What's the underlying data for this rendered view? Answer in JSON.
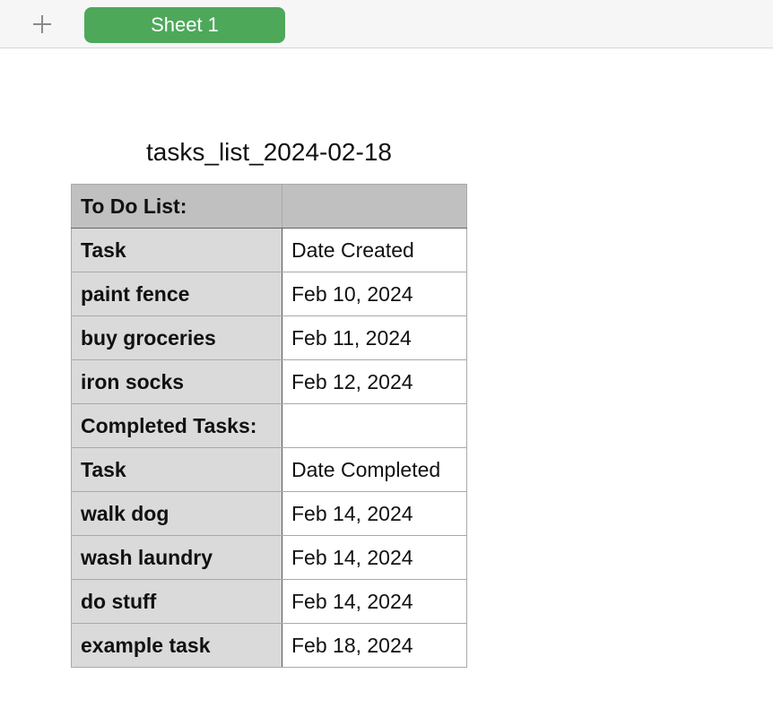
{
  "tabbar": {
    "add_icon": "plus-icon",
    "sheet_tab_label": "Sheet 1",
    "sheet_tab_color": "#4ea85a"
  },
  "table": {
    "title": "tasks_list_2024-02-18",
    "header_row": {
      "c1": "To Do List:",
      "c2": ""
    },
    "rows": [
      {
        "c1": "Task",
        "c2": "Date Created"
      },
      {
        "c1": "paint fence",
        "c2": "Feb 10, 2024"
      },
      {
        "c1": "buy groceries",
        "c2": "Feb 11, 2024"
      },
      {
        "c1": "iron socks",
        "c2": "Feb 12, 2024"
      },
      {
        "c1": "Completed Tasks:",
        "c2": ""
      },
      {
        "c1": "Task",
        "c2": "Date Completed"
      },
      {
        "c1": "walk dog",
        "c2": "Feb 14, 2024"
      },
      {
        "c1": "wash laundry",
        "c2": "Feb 14, 2024"
      },
      {
        "c1": "do stuff",
        "c2": "Feb 14, 2024"
      },
      {
        "c1": "example task",
        "c2": "Feb 18, 2024"
      }
    ]
  }
}
